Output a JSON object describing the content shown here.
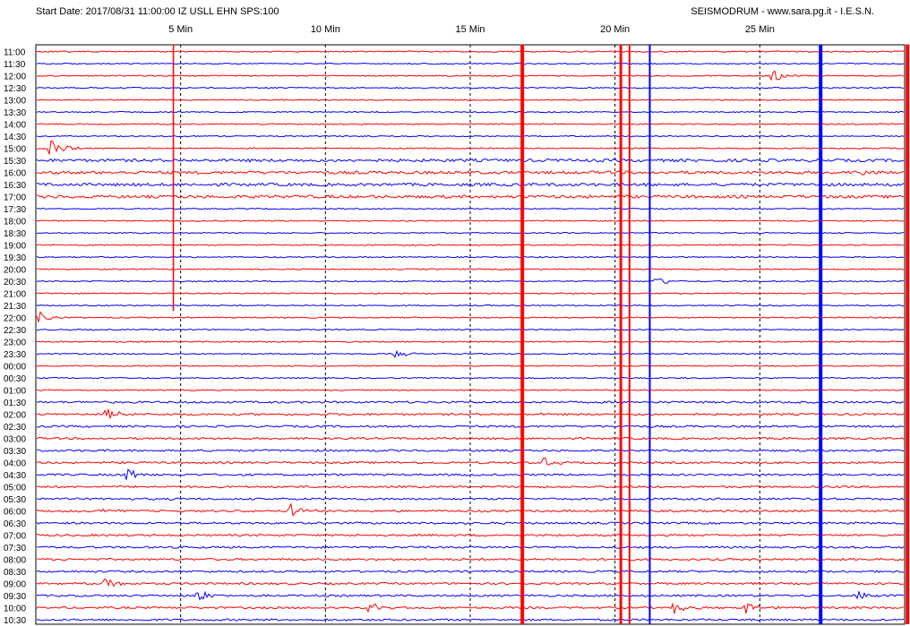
{
  "header": {
    "left": "Start Date: 2017/08/31 11:00:00 IZ USLL EHN SPS:100",
    "right": "SEISMODRUM - www.sara.pg.it - I.E.S.N."
  },
  "chart_data": {
    "type": "seismogram-drum",
    "x_unit": "minutes",
    "xlim": [
      0,
      30
    ],
    "x_ticks": [
      {
        "value": 5,
        "label": "5 Min"
      },
      {
        "value": 10,
        "label": "10 Min"
      },
      {
        "value": 15,
        "label": "15 Min"
      },
      {
        "value": 20,
        "label": "20 Min"
      },
      {
        "value": 25,
        "label": "25 Min"
      }
    ],
    "row_labels": [
      "11:00",
      "11:30",
      "12:00",
      "12:30",
      "13:00",
      "13:30",
      "14:00",
      "14:30",
      "15:00",
      "15:30",
      "16:00",
      "16:30",
      "17:00",
      "17:30",
      "18:00",
      "18:30",
      "19:00",
      "19:30",
      "20:00",
      "20:30",
      "21:00",
      "21:30",
      "22:00",
      "22:30",
      "23:00",
      "23:30",
      "00:00",
      "00:30",
      "01:00",
      "01:30",
      "02:00",
      "02:30",
      "03:00",
      "03:30",
      "04:00",
      "04:30",
      "05:00",
      "05:30",
      "06:00",
      "06:30",
      "07:00",
      "07:30",
      "08:00",
      "08:30",
      "09:00",
      "09:30",
      "10:00",
      "10:30"
    ],
    "trace_colors": [
      "#ff0000",
      "#0000ff"
    ],
    "grid": "dashed vertical lines every 5 minutes",
    "events": [
      {
        "row": 8,
        "minute": 0.5,
        "amplitude": 14,
        "color": "#ff0000"
      },
      {
        "row": 2,
        "minute": 25.4,
        "amplitude": 10,
        "color": "#ff0000"
      },
      {
        "row": 10,
        "minute": 28.3,
        "amplitude": 6,
        "color": "#0000ff"
      },
      {
        "row": 19,
        "minute": 21.4,
        "amplitude": 6,
        "color": "#ff0000"
      },
      {
        "row": 22,
        "minute": 0.0,
        "amplitude": 10,
        "color": "#ff0000"
      },
      {
        "row": 25,
        "minute": 12.4,
        "amplitude": 5,
        "color": "#0000ff"
      },
      {
        "row": 30,
        "minute": 2.4,
        "amplitude": 7,
        "color": "#ff0000"
      },
      {
        "row": 35,
        "minute": 3.1,
        "amplitude": 8,
        "color": "#ff0000"
      },
      {
        "row": 38,
        "minute": 2.2,
        "amplitude": 8,
        "color": "#0000ff"
      },
      {
        "row": 38,
        "minute": 8.8,
        "amplitude": 9,
        "color": "#ff0000"
      },
      {
        "row": 34,
        "minute": 17.5,
        "amplitude": 6,
        "color": "#ff0000"
      },
      {
        "row": 44,
        "minute": 2.3,
        "amplitude": 9,
        "color": "#ff0000"
      },
      {
        "row": 45,
        "minute": 5.5,
        "amplitude": 8,
        "color": "#0000ff"
      },
      {
        "row": 46,
        "minute": 11.5,
        "amplitude": 9,
        "color": "#ff0000"
      },
      {
        "row": 46,
        "minute": 22.0,
        "amplitude": 8,
        "color": "#0000ff"
      },
      {
        "row": 46,
        "minute": 24.5,
        "amplitude": 8,
        "color": "#0000ff"
      },
      {
        "row": 45,
        "minute": 28.3,
        "amplitude": 7,
        "color": "#ff0000"
      }
    ],
    "saturated_columns": [
      {
        "minute": 4.75,
        "row_from": 0,
        "row_to": 21,
        "color": "#ff0000",
        "width": 1.5
      },
      {
        "minute": 16.8,
        "row_from": 0,
        "row_to": 47,
        "color": "#ff0000",
        "width": 4
      },
      {
        "minute": 20.2,
        "row_from": 0,
        "row_to": 47,
        "color": "#ff0000",
        "width": 3
      },
      {
        "minute": 20.5,
        "row_from": 0,
        "row_to": 47,
        "color": "#ff0000",
        "width": 2
      },
      {
        "minute": 21.2,
        "row_from": 0,
        "row_to": 47,
        "color": "#0000ff",
        "width": 2
      },
      {
        "minute": 27.1,
        "row_from": 0,
        "row_to": 47,
        "color": "#0000ff",
        "width": 4
      },
      {
        "minute": 30.1,
        "row_from": 0,
        "row_to": 47,
        "color": "#ff0000",
        "width": 4
      }
    ],
    "active_rows": [
      {
        "from": 9,
        "to": 12,
        "level": 3
      },
      {
        "from": 29,
        "to": 47,
        "level": 2
      }
    ]
  }
}
